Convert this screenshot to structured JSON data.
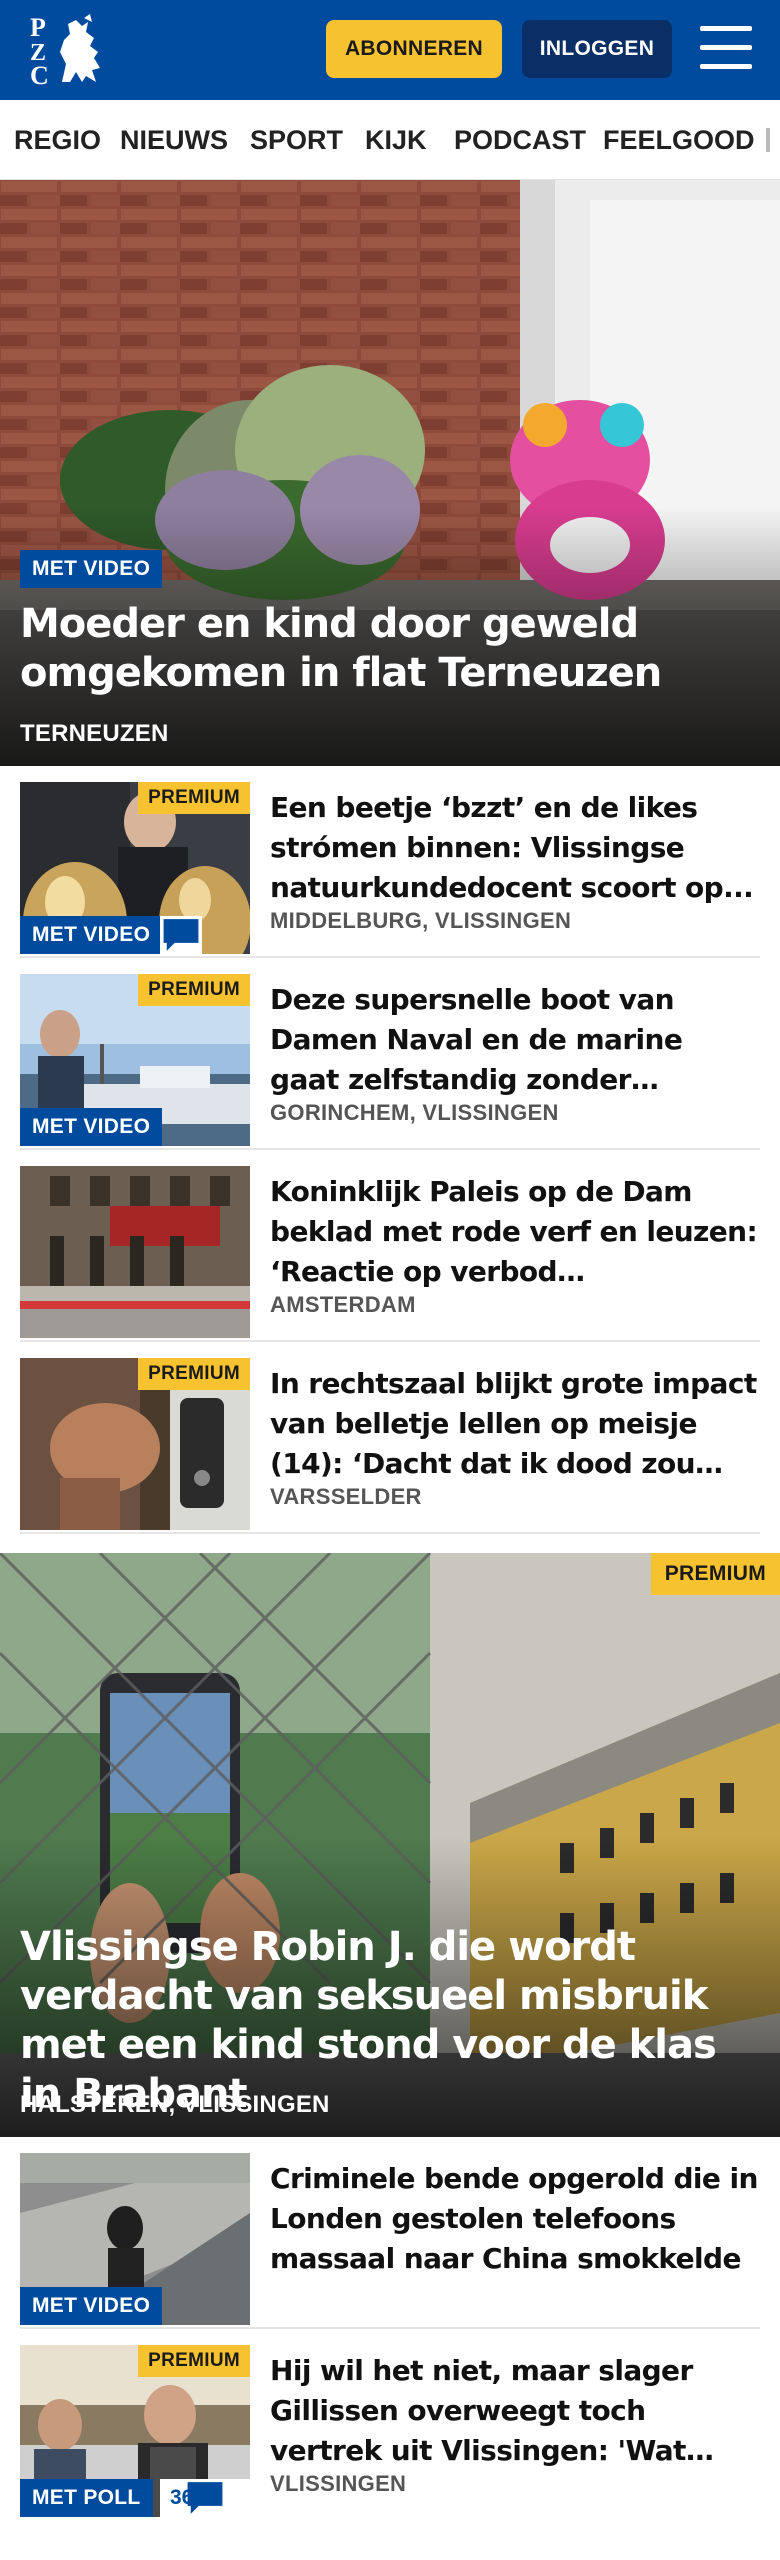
{
  "header": {
    "logo_text": "PZC",
    "subscribe_label": "ABONNEREN",
    "login_label": "INLOGGEN"
  },
  "nav": {
    "items": [
      {
        "label": "REGIO"
      },
      {
        "label": "NIEUWS"
      },
      {
        "label": "SPORT"
      },
      {
        "label": "KIJK"
      },
      {
        "label": "PODCAST"
      },
      {
        "label": "FEELGOOD"
      }
    ]
  },
  "hero": {
    "badge": "MET VIDEO",
    "title": "Moeder en kind door geweld omgekomen in flat Terneuzen",
    "location": "TERNEUZEN"
  },
  "articles": [
    {
      "premium": "PREMIUM",
      "badge": "MET VIDEO",
      "title": "Een beetje ‘bzzt’ en de likes strómen binnen: Vlissingse natuurkundedocent scoort op...",
      "location": "MIDDELBURG, VLISSINGEN"
    },
    {
      "premium": "PREMIUM",
      "badge": "MET VIDEO",
      "title": "Deze supersnelle boot van Damen Naval en de marine gaat zelfstandig zonder bemanning ...",
      "location": "GORINCHEM, VLISSINGEN"
    },
    {
      "title": "Koninklijk Paleis op de Dam beklad met rode verf en leuzen: ‘Reactie op verbod burgemees-...",
      "location": "AMSTERDAM"
    },
    {
      "premium": "PREMIUM",
      "title": "In rechtszaal blijkt grote impact van belletje lellen op meisje (14): ‘Dacht dat ik dood zou gaan’",
      "location": "VARSSELDER"
    }
  ],
  "feature": {
    "premium": "PREMIUM",
    "title": "Vlissingse Robin J. die wordt verdacht van seksueel misbruik met een kind stond voor de klas in Brabant",
    "location": "HALSTEREN, VLISSINGEN"
  },
  "articles2": [
    {
      "badge": "MET VIDEO",
      "title": "Criminele bende opgerold die in Londen gestolen telefoons massaal naar China smokkelde"
    },
    {
      "premium": "PREMIUM",
      "badge": "MET POLL",
      "comment_count": "36",
      "title": "Hij wil het niet, maar slager Gillissen overweegt toch vertrek uit Vlissingen: 'Wat houden we...",
      "location": "VLISSINGEN"
    }
  ]
}
